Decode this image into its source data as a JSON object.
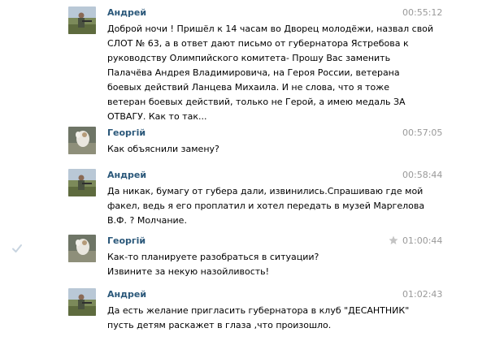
{
  "messages": [
    {
      "author": "Андрей",
      "avatar": "andrey-avatar",
      "time": "00:55:12",
      "lines": [
        "Доброй ночи ! Пришёл к 14 часам во Дворец молодёжи, назвал свой",
        "СЛОТ № 63, а в ответ дают письмо от губернатора Ястребова к",
        "руководству Олимпийского комитета- Прошу Вас заменить",
        "Палачёва Андрея Владимировича, на Героя России, ветерана",
        "боевых действий Ланцева Михаила. И не слова, что я тоже",
        "ветеран боевых действий, только не Герой, а имею медаль ЗА",
        "ОТВАГУ. Как то так..."
      ]
    },
    {
      "author": "Георгій",
      "avatar": "georgiy-avatar",
      "time": "00:57:05",
      "lines": [
        "Как объяснили замену?"
      ]
    },
    {
      "author": "Андрей",
      "avatar": "andrey-avatar",
      "time": "00:58:44",
      "lines": [
        "Да никак, бумагу от губера дали, извинились.Спрашиваю где мой",
        "факел, ведь я его проплатил и хотел передать в музей Маргелова",
        "В.Ф. ? Молчание."
      ]
    },
    {
      "author": "Георгій",
      "avatar": "georgiy-avatar",
      "time": "01:00:44",
      "lines": [
        "Как-то планируете разобраться в ситуации?",
        "Извините за некую назойливость!"
      ],
      "has_check": true,
      "has_star": true
    },
    {
      "author": "Андрей",
      "avatar": "andrey-avatar",
      "time": "01:02:43",
      "lines": [
        "Да есть желание пригласить губернатора в клуб \"ДЕСАНТНИК\"",
        "пусть детям раскажет в глаза ,что произошло."
      ]
    }
  ],
  "colors": {
    "author": "#2b587a",
    "time": "#999999",
    "check": "#c8d4e0",
    "star": "#c4c4c4"
  }
}
